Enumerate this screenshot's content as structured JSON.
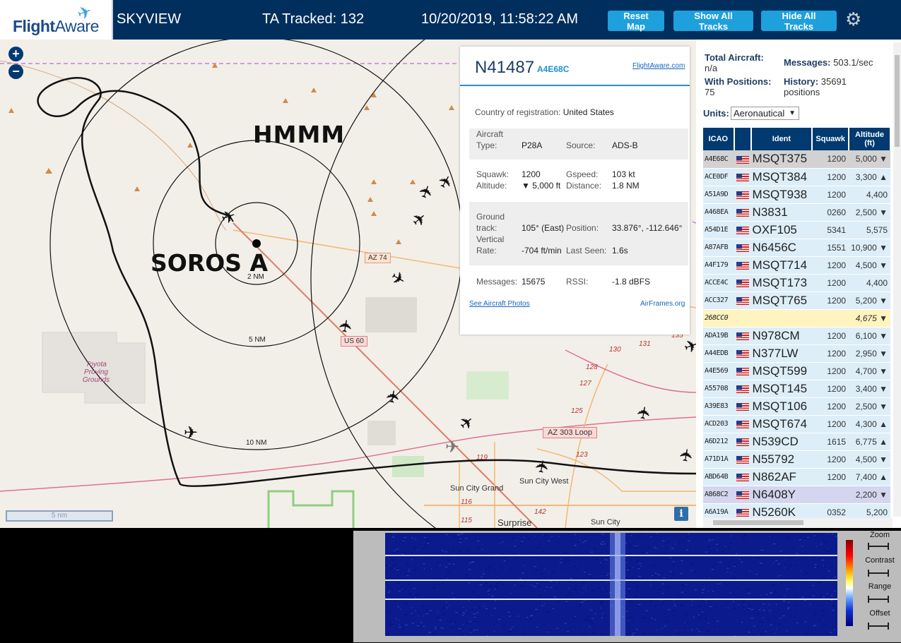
{
  "header": {
    "logo_text_bold": "Flight",
    "logo_text_light": "Aware",
    "title": "SKYVIEW",
    "tracked": "TA Tracked: 132",
    "datetime": "10/20/2019, 11:58:22 AM",
    "buttons": {
      "reset": "Reset Map",
      "show_all": "Show All Tracks",
      "hide_all": "Hide All Tracks"
    },
    "settings_icon": "gear-icon"
  },
  "map": {
    "zoom_in": "+",
    "zoom_out": "−",
    "annotation_top": "HMMM",
    "annotation_center": "SOROS A",
    "range_rings": [
      "2 NM",
      "5 NM",
      "10 NM"
    ],
    "road_labels": [
      "AZ 74",
      "US 60",
      "AZ 303 Loop"
    ],
    "route_numbers": [
      "130",
      "131",
      "128",
      "127",
      "125",
      "123",
      "119",
      "116",
      "115",
      "142",
      "135"
    ],
    "places": [
      "Toyota Proving Grounds",
      "Sun City Grand",
      "Sun City West",
      "Surprise",
      "Sun City"
    ],
    "scale": "5 nm",
    "info": "i"
  },
  "popup": {
    "registration": "N41487",
    "icao": "A4E68C",
    "link": "FlightAware.com",
    "country_label": "Country of registration:",
    "country": "United States",
    "aircraft_type_label_1": "Aircraft",
    "aircraft_type_label_2": "Type:",
    "aircraft_type": "P28A",
    "source_label": "Source:",
    "source": "ADS-B",
    "squawk_label": "Squawk:",
    "squawk": "1200",
    "gspeed_label": "Gspeed:",
    "gspeed": "103 kt",
    "altitude_label": "Altitude:",
    "altitude": "▼ 5,000 ft",
    "distance_label": "Distance:",
    "distance": "1.8 NM",
    "track_label_1": "Ground",
    "track_label_2": "track:",
    "track": "105° (East)",
    "position_label": "Position:",
    "position": "33.876°, -112.646°",
    "vrate_label_1": "Vertical",
    "vrate_label_2": "Rate:",
    "vrate": "-704 ft/min",
    "lastseen_label": "Last Seen:",
    "lastseen": "1.6s",
    "messages_label": "Messages:",
    "messages": "15675",
    "rssi_label": "RSSI:",
    "rssi": "-1.8 dBFS",
    "photos_link": "See Aircraft Photos",
    "airframes_link": "AirFrames.org"
  },
  "stats": {
    "total_label": "Total Aircraft:",
    "total": "n/a",
    "messages_label": "Messages:",
    "messages": "503.1/sec",
    "positions_label": "With Positions:",
    "positions": "75",
    "history_label": "History:",
    "history_value": "35691",
    "history_unit": "positions",
    "units_label": "Units:",
    "units_value": "Aeronautical"
  },
  "table": {
    "headers": {
      "icao": "ICAO",
      "ident": "Ident",
      "squawk": "Squawk",
      "altitude_1": "Altitude",
      "altitude_2": "(ft)"
    },
    "rows": [
      {
        "icao": "A4E68C",
        "ident": "MSQT375",
        "squawk": "1200",
        "alt": "5,000 ▼",
        "flag": true
      },
      {
        "icao": "ACE0DF",
        "ident": "MSQT384",
        "squawk": "1200",
        "alt": "3,300 ▲",
        "flag": true
      },
      {
        "icao": "A51A9D",
        "ident": "MSQT938",
        "squawk": "1200",
        "alt": "4,400",
        "flag": true
      },
      {
        "icao": "A468EA",
        "ident": "N3831",
        "squawk": "0260",
        "alt": "2,500 ▼",
        "flag": true
      },
      {
        "icao": "A54D1E",
        "ident": "OXF105",
        "squawk": "5341",
        "alt": "5,575",
        "flag": true
      },
      {
        "icao": "A87AFB",
        "ident": "N6456C",
        "squawk": "1551",
        "alt": "10,900 ▼",
        "flag": true
      },
      {
        "icao": "A4F179",
        "ident": "MSQT714",
        "squawk": "1200",
        "alt": "4,500 ▼",
        "flag": true
      },
      {
        "icao": "ACCE4C",
        "ident": "MSQT173",
        "squawk": "1200",
        "alt": "4,400",
        "flag": true
      },
      {
        "icao": "ACC327",
        "ident": "MSQT765",
        "squawk": "1200",
        "alt": "5,200 ▼",
        "flag": true
      },
      {
        "icao": "268CC0",
        "ident": "",
        "squawk": "",
        "alt": "4,675 ▼",
        "flag": false
      },
      {
        "icao": "ADA19B",
        "ident": "N978CM",
        "squawk": "1200",
        "alt": "6,100 ▼",
        "flag": true
      },
      {
        "icao": "A44EDB",
        "ident": "N377LW",
        "squawk": "1200",
        "alt": "2,950 ▼",
        "flag": true
      },
      {
        "icao": "A4E569",
        "ident": "MSQT599",
        "squawk": "1200",
        "alt": "4,700 ▼",
        "flag": true
      },
      {
        "icao": "A55708",
        "ident": "MSQT145",
        "squawk": "1200",
        "alt": "3,400 ▼",
        "flag": true
      },
      {
        "icao": "A39E83",
        "ident": "MSQT106",
        "squawk": "1200",
        "alt": "2,500 ▼",
        "flag": true
      },
      {
        "icao": "ACD203",
        "ident": "MSQT674",
        "squawk": "1200",
        "alt": "4,300 ▲",
        "flag": true
      },
      {
        "icao": "A6D212",
        "ident": "N539CD",
        "squawk": "1615",
        "alt": "6,775 ▲",
        "flag": true
      },
      {
        "icao": "A71D1A",
        "ident": "N55792",
        "squawk": "1200",
        "alt": "4,500 ▼",
        "flag": true
      },
      {
        "icao": "ABD64B",
        "ident": "N862AF",
        "squawk": "1200",
        "alt": "7,400 ▲",
        "flag": true
      },
      {
        "icao": "A868C2",
        "ident": "N6408Y",
        "squawk": "",
        "alt": "2,200 ▼",
        "flag": true
      },
      {
        "icao": "A6A19A",
        "ident": "N5260K",
        "squawk": "0352",
        "alt": "5,200",
        "flag": true
      }
    ]
  },
  "waterfall": {
    "zoom": "Zoom",
    "contrast": "Contrast",
    "range": "Range",
    "offset": "Offset"
  },
  "colors": {
    "header_bg": "#002f5d",
    "button": "#1ea0dc",
    "table_header": "#003a70",
    "waterfall_bg": "#0b1a8c"
  }
}
